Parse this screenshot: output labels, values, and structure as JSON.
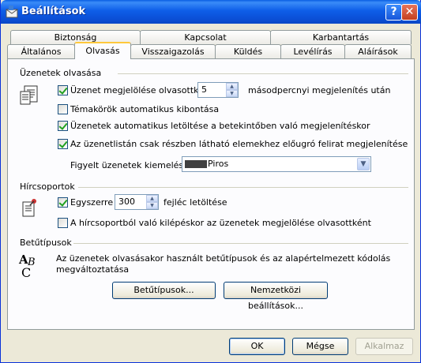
{
  "window": {
    "title": "Beállítások",
    "help_label": "?",
    "close_label": "✕"
  },
  "tabs_row1": [
    {
      "label": "Biztonság"
    },
    {
      "label": "Kapcsolat"
    },
    {
      "label": "Karbantartás"
    }
  ],
  "tabs_row2": [
    {
      "label": "Általános"
    },
    {
      "label": "Olvasás"
    },
    {
      "label": "Visszaigazolás"
    },
    {
      "label": "Küldés"
    },
    {
      "label": "Levélírás"
    },
    {
      "label": "Aláírások"
    }
  ],
  "active_tab": "Olvasás",
  "reading": {
    "heading": "Üzenetek olvasása",
    "mark_read": {
      "label": "Üzenet megjelölése olvasottként",
      "checked": true
    },
    "mark_read_seconds": "5",
    "mark_read_suffix": "másodpercnyi megjelenítés után",
    "auto_expand": {
      "label": "Témakörök automatikus kibontása",
      "checked": false
    },
    "auto_download": {
      "label": "Üzenetek automatikus letöltése a betekintőben való megjelenítéskor",
      "checked": true
    },
    "tooltip": {
      "label": "Az üzenetlistán csak részben látható elemekhez előugró felirat megjelenítése",
      "checked": true
    },
    "highlight_label": "Figyelt üzenetek kiemelése:",
    "highlight_value": "Piros",
    "highlight_color": "#404040"
  },
  "news": {
    "heading": "Hírcsoportok",
    "fetch": {
      "label": "Egyszerre",
      "checked": true
    },
    "fetch_count": "300",
    "fetch_suffix": "fejléc letöltése",
    "mark_on_exit": {
      "label": "A hírcsoportból való kilépéskor az üzenetek megjelölése olvasottként",
      "checked": false
    }
  },
  "fonts": {
    "heading": "Betűtípusok",
    "description_line1": "Az üzenetek olvasásakor használt betűtípusok és az alapértelmezett kódolás",
    "description_line2": "megváltoztatása",
    "fonts_button": "Betűtípusok...",
    "intl_button": "Nemzetközi beállítások..."
  },
  "footer": {
    "ok": "OK",
    "cancel": "Mégse",
    "apply": "Alkalmaz"
  }
}
